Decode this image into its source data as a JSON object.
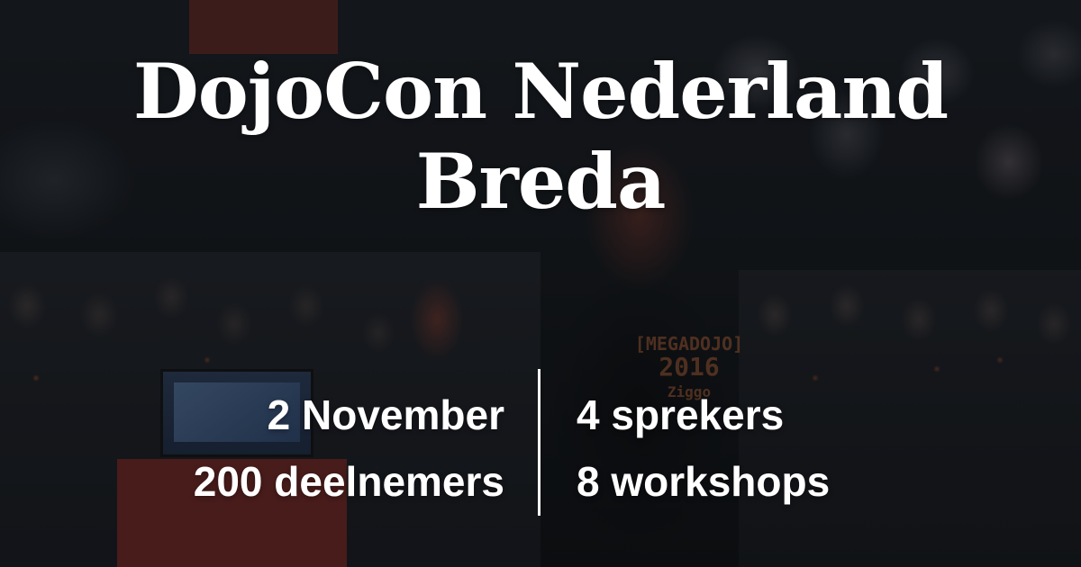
{
  "title": {
    "line1": "DojoCon Nederland",
    "line2": "Breda"
  },
  "stats": {
    "left": [
      "2 November",
      "200 deelnemers"
    ],
    "right": [
      "4 sprekers",
      "8 workshops"
    ]
  },
  "background": {
    "shirt_print": [
      "[MEGADOJO]",
      "2016",
      "Ziggo"
    ]
  },
  "colors": {
    "text": "#ffffff",
    "background": "#0e1013",
    "accent_red": "#962d23"
  }
}
